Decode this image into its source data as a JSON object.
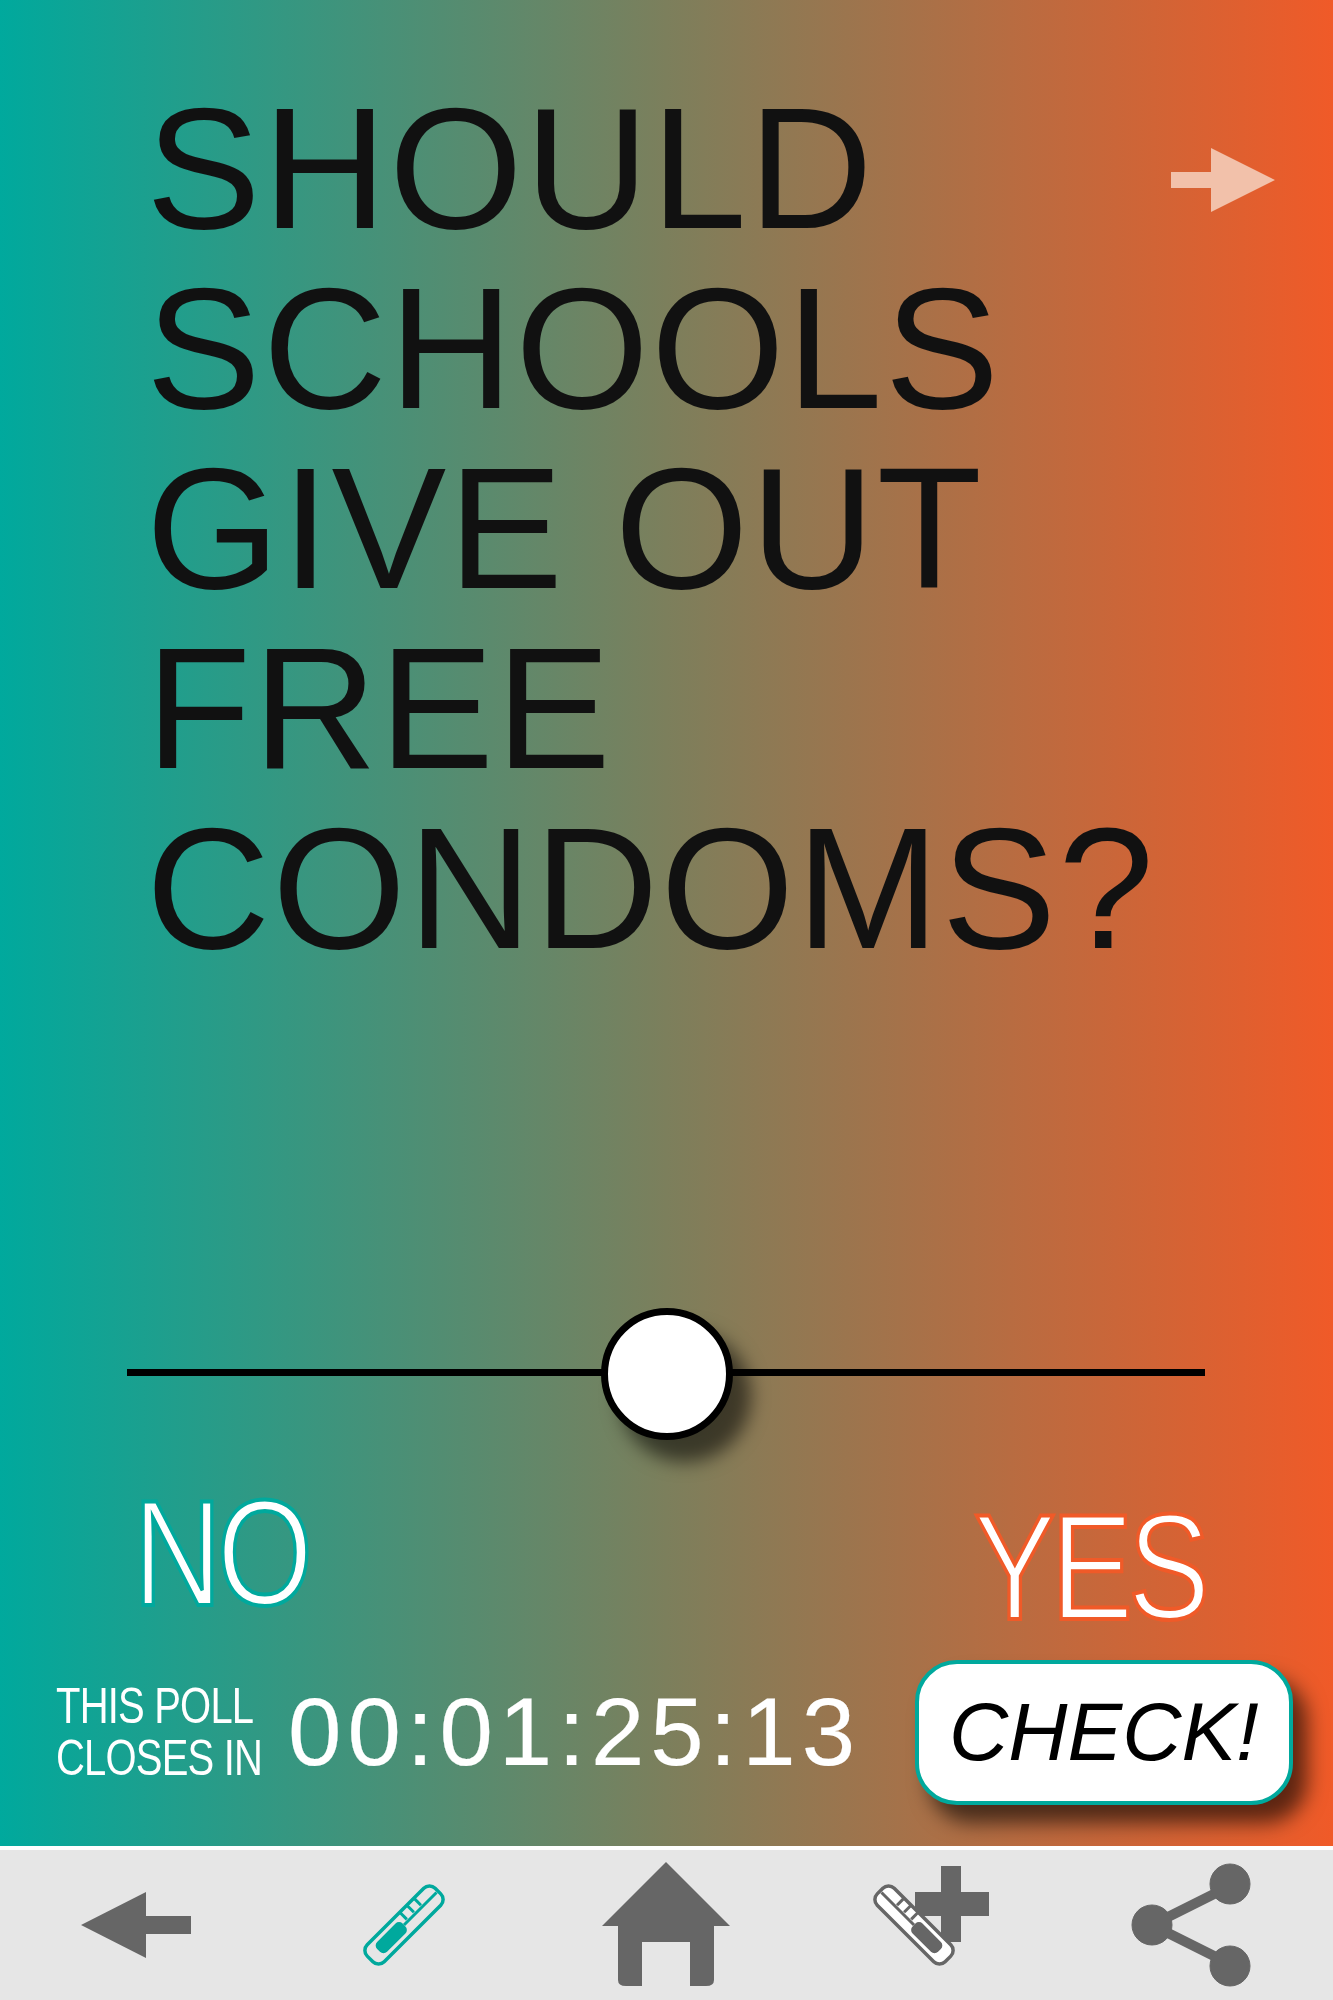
{
  "question": "SHOULD SCHOOLS GIVE OUT FREE CONDOMS?",
  "slider": {
    "level": 0.5,
    "min_label": "NO",
    "max_label": "YES"
  },
  "poll_timer": {
    "label": "THIS POLL CLOSES IN",
    "countdown": "00:01:25:13"
  },
  "check_button": {
    "label": "CHECK!"
  },
  "nav": [
    {
      "kind": "back",
      "selected": false
    },
    {
      "kind": "syringe",
      "selected": true
    },
    {
      "kind": "home",
      "selected": false
    },
    {
      "kind": "syringe-add",
      "selected": false
    },
    {
      "kind": "share",
      "selected": false
    }
  ]
}
